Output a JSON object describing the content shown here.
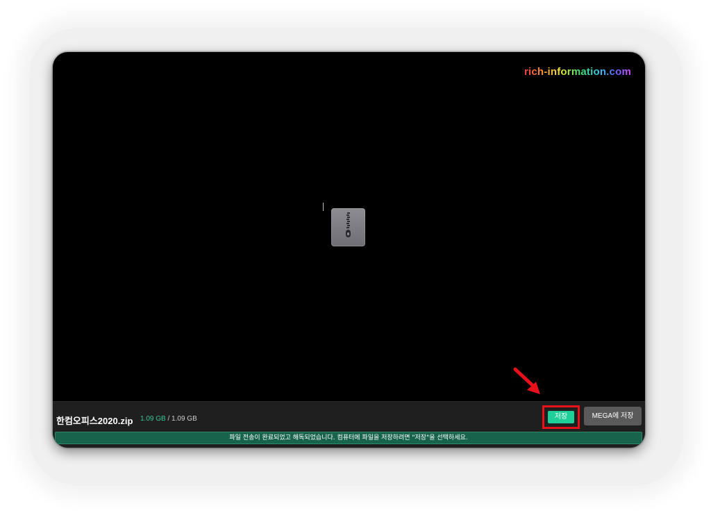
{
  "watermark": {
    "text": "rich-information.com"
  },
  "preview": {
    "file_icon": "zip-file-icon"
  },
  "file": {
    "name": "한컴오피스2020.zip",
    "downloaded": "1.09 GB",
    "separator": "/",
    "total": "1.09 GB"
  },
  "actions": {
    "save_label": "저장",
    "save_to_mega_label": "MEGA에 저장"
  },
  "status": {
    "message": "파일 전송이 완료되었고 해독되었습니다. 컴퓨터에 파일을 저장하려면 \"저장\"을 선택하세요."
  },
  "colors": {
    "accent": "#1fcf98",
    "banner": "#17634b",
    "highlight": "#e8101a",
    "arrow": "#e8101a"
  },
  "annotation_icon": "red-arrow-icon"
}
